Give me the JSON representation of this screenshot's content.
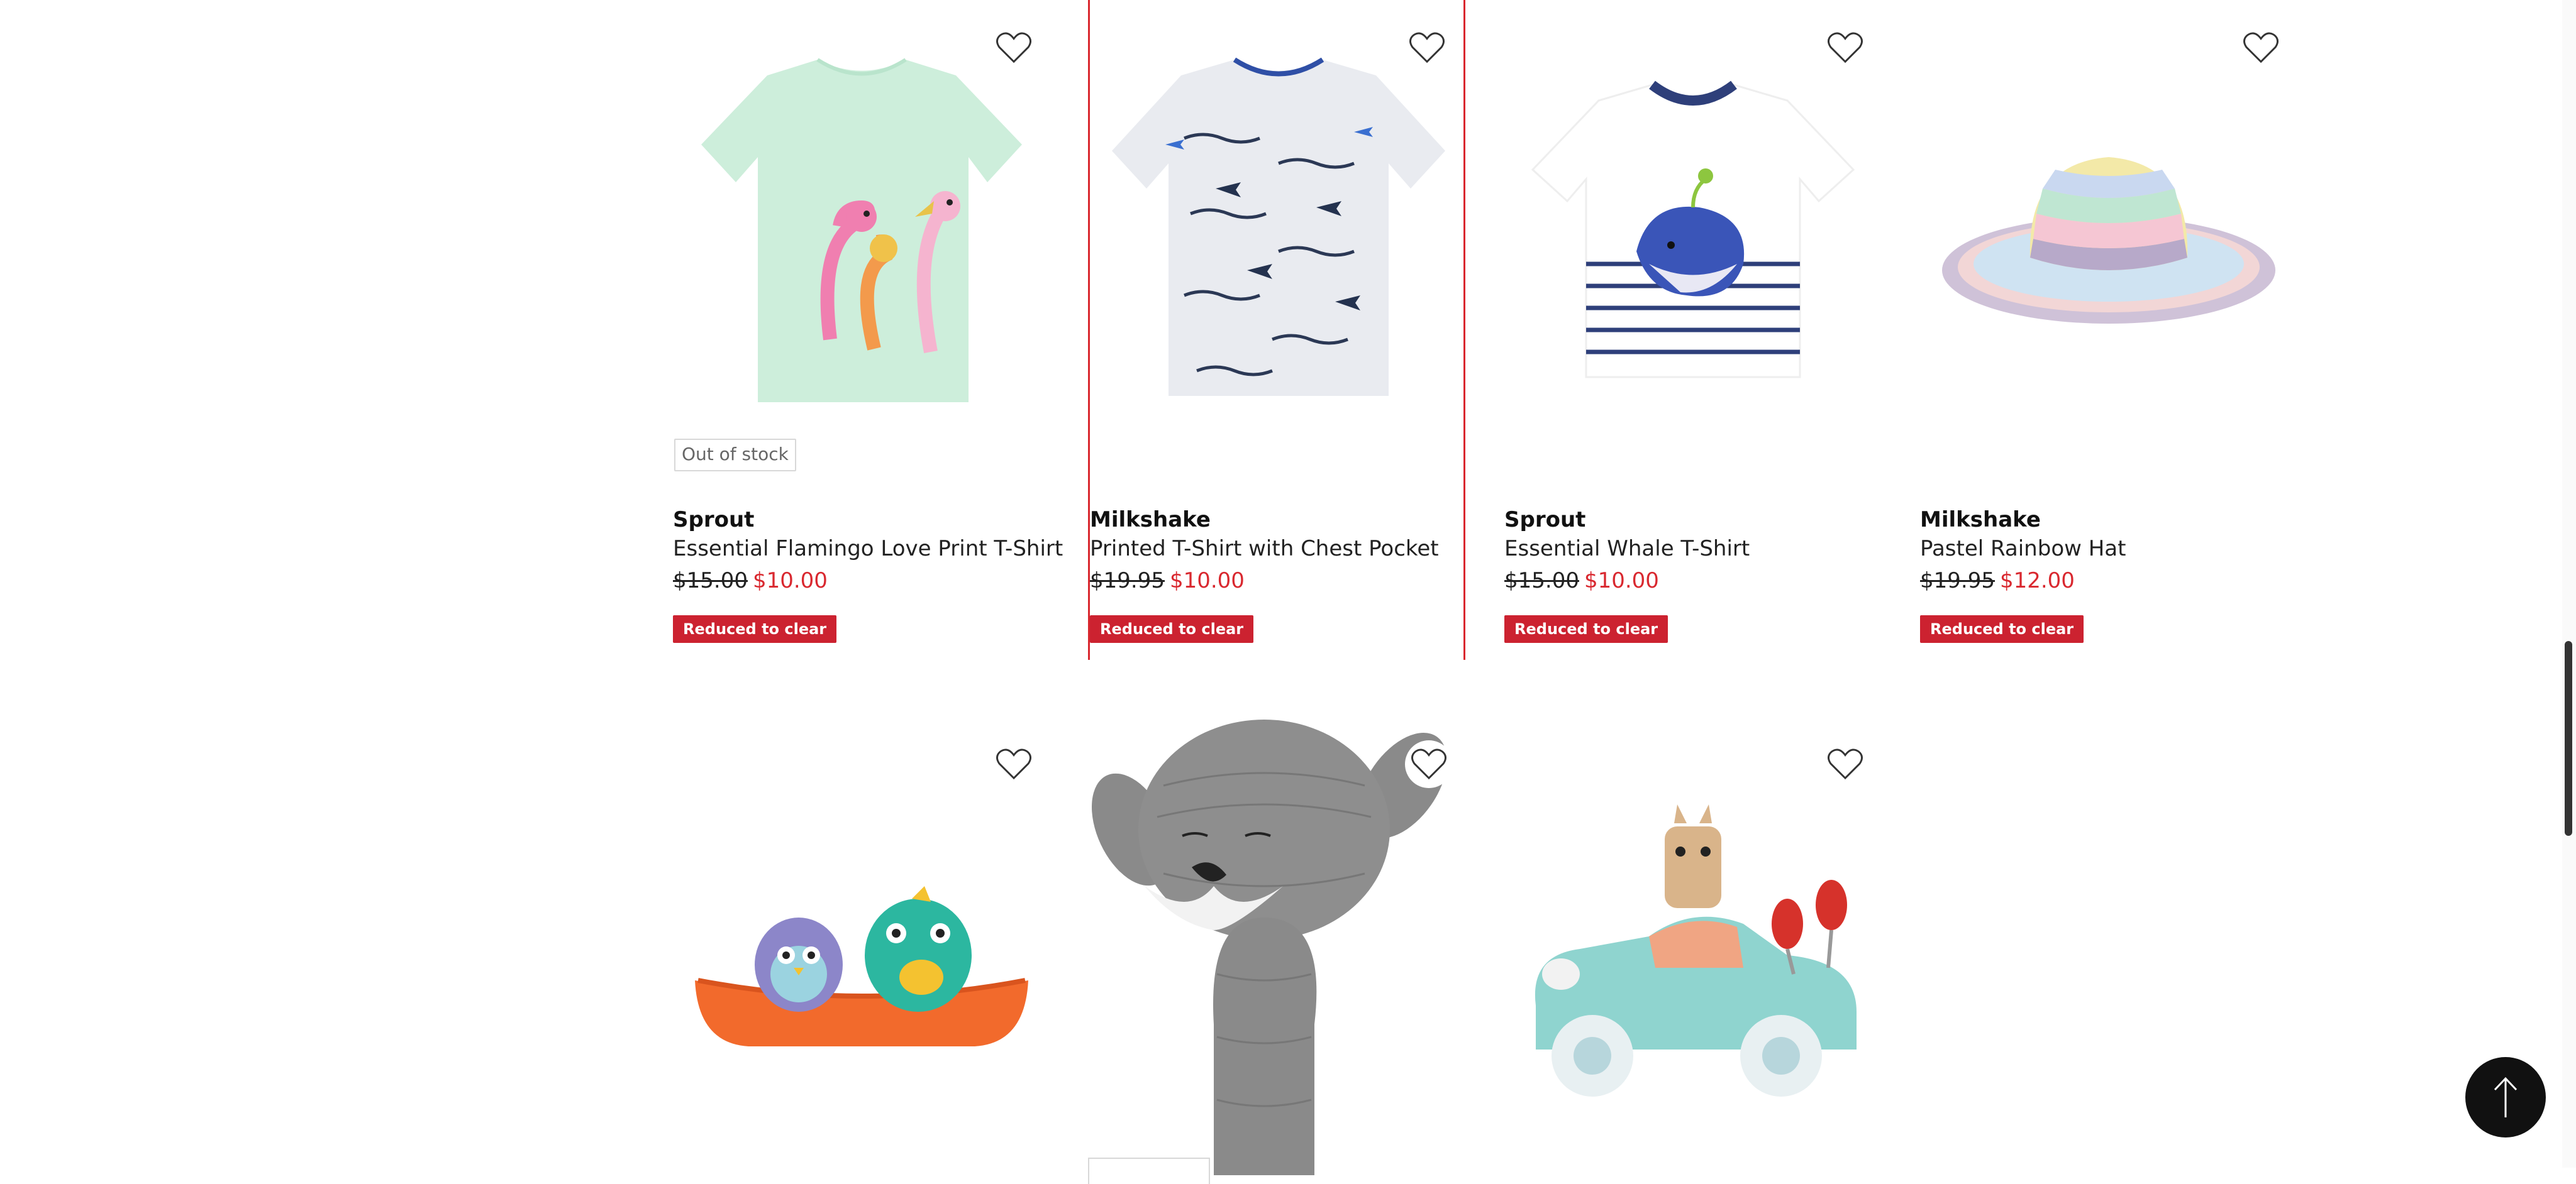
{
  "products": [
    {
      "brand": "Sprout",
      "name": "Essential Flamingo Love Print T-Shirt",
      "was_price": "$15.00",
      "now_price": "$10.00",
      "badge": "Reduced to clear",
      "stock_status": "Out of stock"
    },
    {
      "brand": "Milkshake",
      "name": "Printed T-Shirt with Chest Pocket",
      "was_price": "$19.95",
      "now_price": "$10.00",
      "badge": "Reduced to clear"
    },
    {
      "brand": "Sprout",
      "name": "Essential Whale T-Shirt",
      "was_price": "$15.00",
      "now_price": "$10.00",
      "badge": "Reduced to clear"
    },
    {
      "brand": "Milkshake",
      "name": "Pastel Rainbow Hat",
      "was_price": "$19.95",
      "now_price": "$12.00",
      "badge": "Reduced to clear"
    }
  ],
  "icons": {
    "wishlist": "heart-outline-icon",
    "back_to_top": "arrow-up-icon"
  },
  "colors": {
    "sale_red": "#d9282f",
    "badge_red": "#cc2230",
    "focus_border": "#d9282f"
  }
}
